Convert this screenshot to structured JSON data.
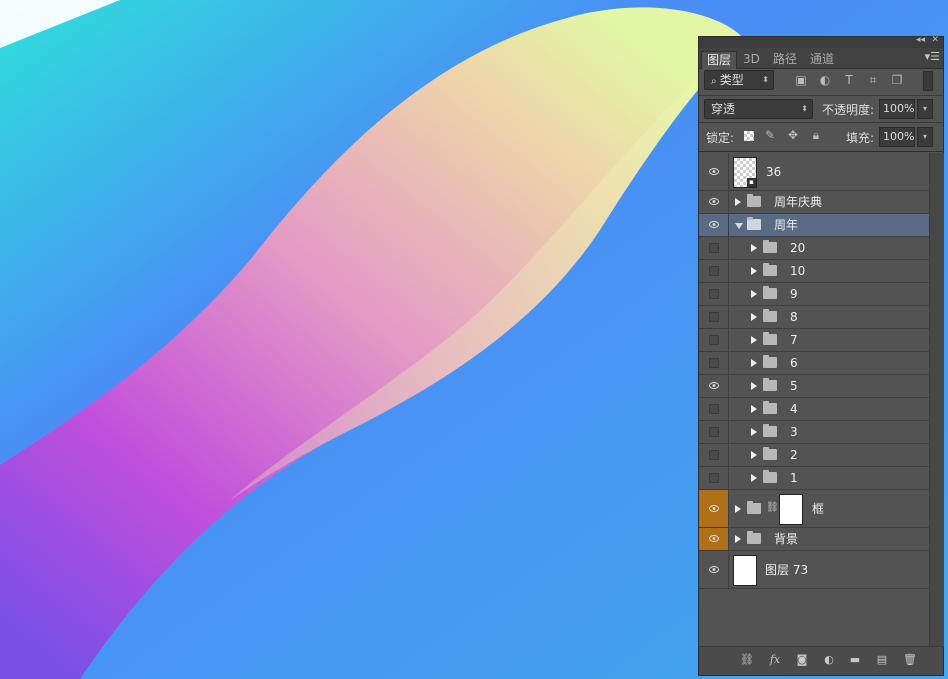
{
  "panel": {
    "tabs": [
      "图层",
      "3D",
      "路径",
      "通道"
    ],
    "active_tab": 0,
    "filter_kind": "类型",
    "blend_mode": "穿透",
    "opacity_label": "不透明度:",
    "opacity_value": "100%",
    "lock_label": "锁定:",
    "fill_label": "填充:",
    "fill_value": "100%",
    "filter_icons": [
      "image-filter-icon",
      "adjustment-filter-icon",
      "type-filter-icon",
      "shape-filter-icon",
      "smart-object-filter-icon"
    ],
    "lock_icons": [
      "lock-transparent-pixels-icon",
      "lock-image-pixels-icon",
      "lock-position-icon",
      "lock-all-icon"
    ],
    "footer_icons": [
      "link-layers-icon",
      "fx-icon",
      "add-mask-icon",
      "new-adjustment-layer-icon",
      "new-group-icon",
      "new-layer-icon",
      "delete-layer-icon"
    ]
  },
  "layers": [
    {
      "name": "36",
      "type": "smart-object",
      "visible": true
    },
    {
      "name": "周年庆典",
      "type": "group",
      "visible": true,
      "indent": 0,
      "expanded": false
    },
    {
      "name": "周年",
      "type": "group",
      "visible": true,
      "indent": 0,
      "expanded": true,
      "selected": true
    },
    {
      "name": "20",
      "type": "group",
      "visible": false,
      "indent": 1
    },
    {
      "name": "10",
      "type": "group",
      "visible": false,
      "indent": 1
    },
    {
      "name": "9",
      "type": "group",
      "visible": false,
      "indent": 1
    },
    {
      "name": "8",
      "type": "group",
      "visible": false,
      "indent": 1
    },
    {
      "name": "7",
      "type": "group",
      "visible": false,
      "indent": 1
    },
    {
      "name": "6",
      "type": "group",
      "visible": false,
      "indent": 1
    },
    {
      "name": "5",
      "type": "group",
      "visible": true,
      "indent": 1
    },
    {
      "name": "4",
      "type": "group",
      "visible": false,
      "indent": 1
    },
    {
      "name": "3",
      "type": "group",
      "visible": false,
      "indent": 1
    },
    {
      "name": "2",
      "type": "group",
      "visible": false,
      "indent": 1
    },
    {
      "name": "1",
      "type": "group",
      "visible": false,
      "indent": 1
    },
    {
      "name": "框",
      "type": "group-masked",
      "visible": true,
      "highlight": true
    },
    {
      "name": "背景",
      "type": "group",
      "visible": true,
      "highlight": true
    },
    {
      "name": "图层 73",
      "type": "layer",
      "visible": true
    }
  ],
  "colors": {
    "canvas_bg": "#4a8df5",
    "panel_bg": "#535353",
    "selected_row": "#586a84",
    "eye_highlight": "#b07018"
  }
}
